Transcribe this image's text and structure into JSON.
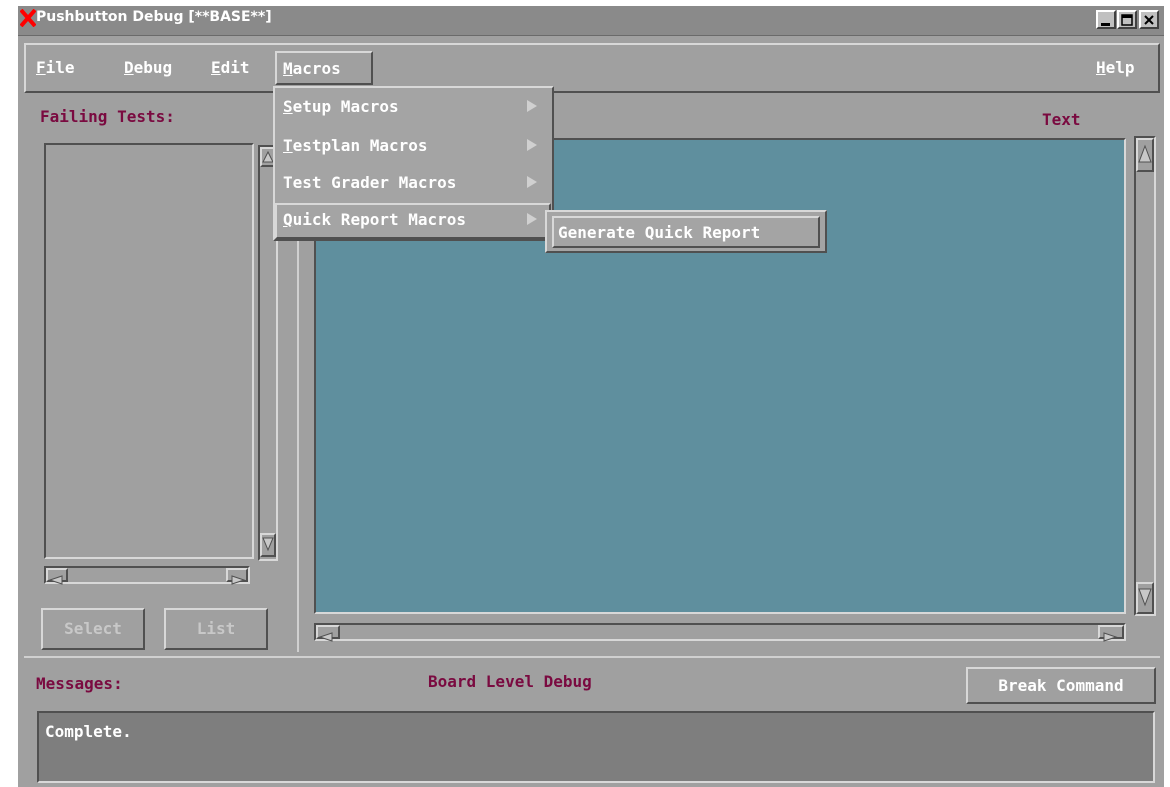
{
  "window": {
    "title": "Pushbutton Debug [**BASE**]",
    "colors": {
      "frame": "#a0a0a0",
      "text_area": "#5f8f9e",
      "label": "#7a0a40",
      "logo": "#ff0000"
    }
  },
  "title_controls": {
    "minimize": "minimize-icon",
    "maximize": "maximize-icon",
    "close": "close-icon"
  },
  "menubar": {
    "file": {
      "first": "F",
      "rest": "ile"
    },
    "debug": {
      "first": "D",
      "rest": "ebug"
    },
    "edit": {
      "first": "E",
      "rest": "dit"
    },
    "macros": {
      "first": "M",
      "rest": "acros"
    },
    "help": {
      "first": "H",
      "rest": "elp"
    }
  },
  "macros_menu": [
    {
      "first": "S",
      "rest": "etup Macros"
    },
    {
      "first": "T",
      "rest": "estplan Macros"
    },
    {
      "first": "",
      "rest": "Test Grader Macros"
    },
    {
      "first": "Q",
      "rest": "uick Report Macros"
    }
  ],
  "submenu": {
    "label": "Generate Quick Report"
  },
  "left_panel": {
    "label": "Failing Tests:",
    "select_button": "Select",
    "list_button": "List"
  },
  "right_panel": {
    "label": "Text"
  },
  "bottom": {
    "messages_label": "Messages:",
    "status": "Board Level Debug",
    "break_button": "Break Command",
    "message_text": "Complete."
  }
}
